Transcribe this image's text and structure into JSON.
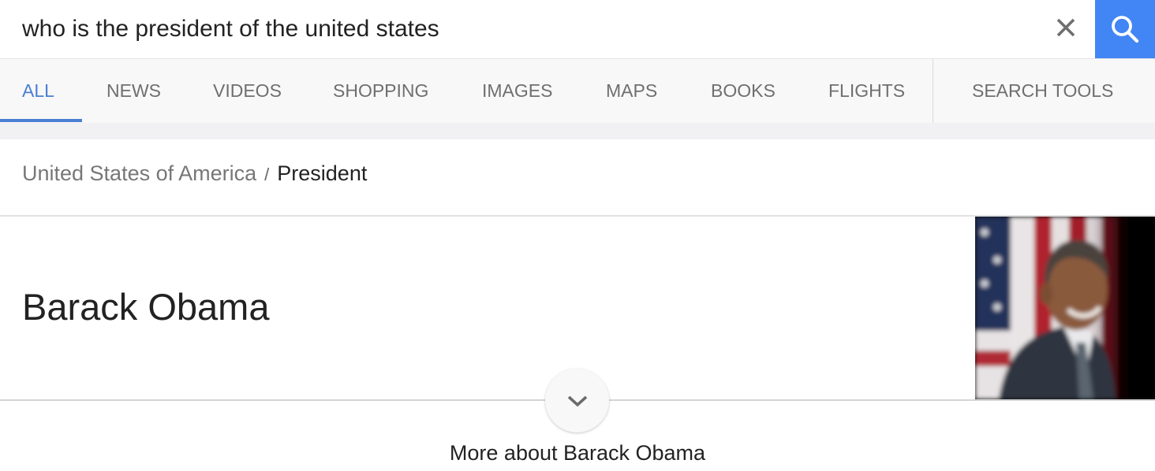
{
  "search": {
    "query": "who is the president of the united states",
    "clear_icon": "close-icon",
    "submit_icon": "search-icon",
    "accent_color": "#4285f4"
  },
  "tabs": {
    "items": [
      {
        "label": "ALL",
        "active": true
      },
      {
        "label": "NEWS",
        "active": false
      },
      {
        "label": "VIDEOS",
        "active": false
      },
      {
        "label": "SHOPPING",
        "active": false
      },
      {
        "label": "IMAGES",
        "active": false
      },
      {
        "label": "MAPS",
        "active": false
      },
      {
        "label": "BOOKS",
        "active": false
      },
      {
        "label": "FLIGHTS",
        "active": false
      }
    ],
    "search_tools": "SEARCH TOOLS",
    "active_color": "#4a7fd4"
  },
  "knowledge_card": {
    "breadcrumb": {
      "parent": "United States of America",
      "separator": "/",
      "current": "President"
    },
    "answer": "Barack Obama",
    "photo_alt": "Photo of Barack Obama",
    "expand_icon": "chevron-down-icon",
    "more_link": "More about Barack Obama"
  }
}
